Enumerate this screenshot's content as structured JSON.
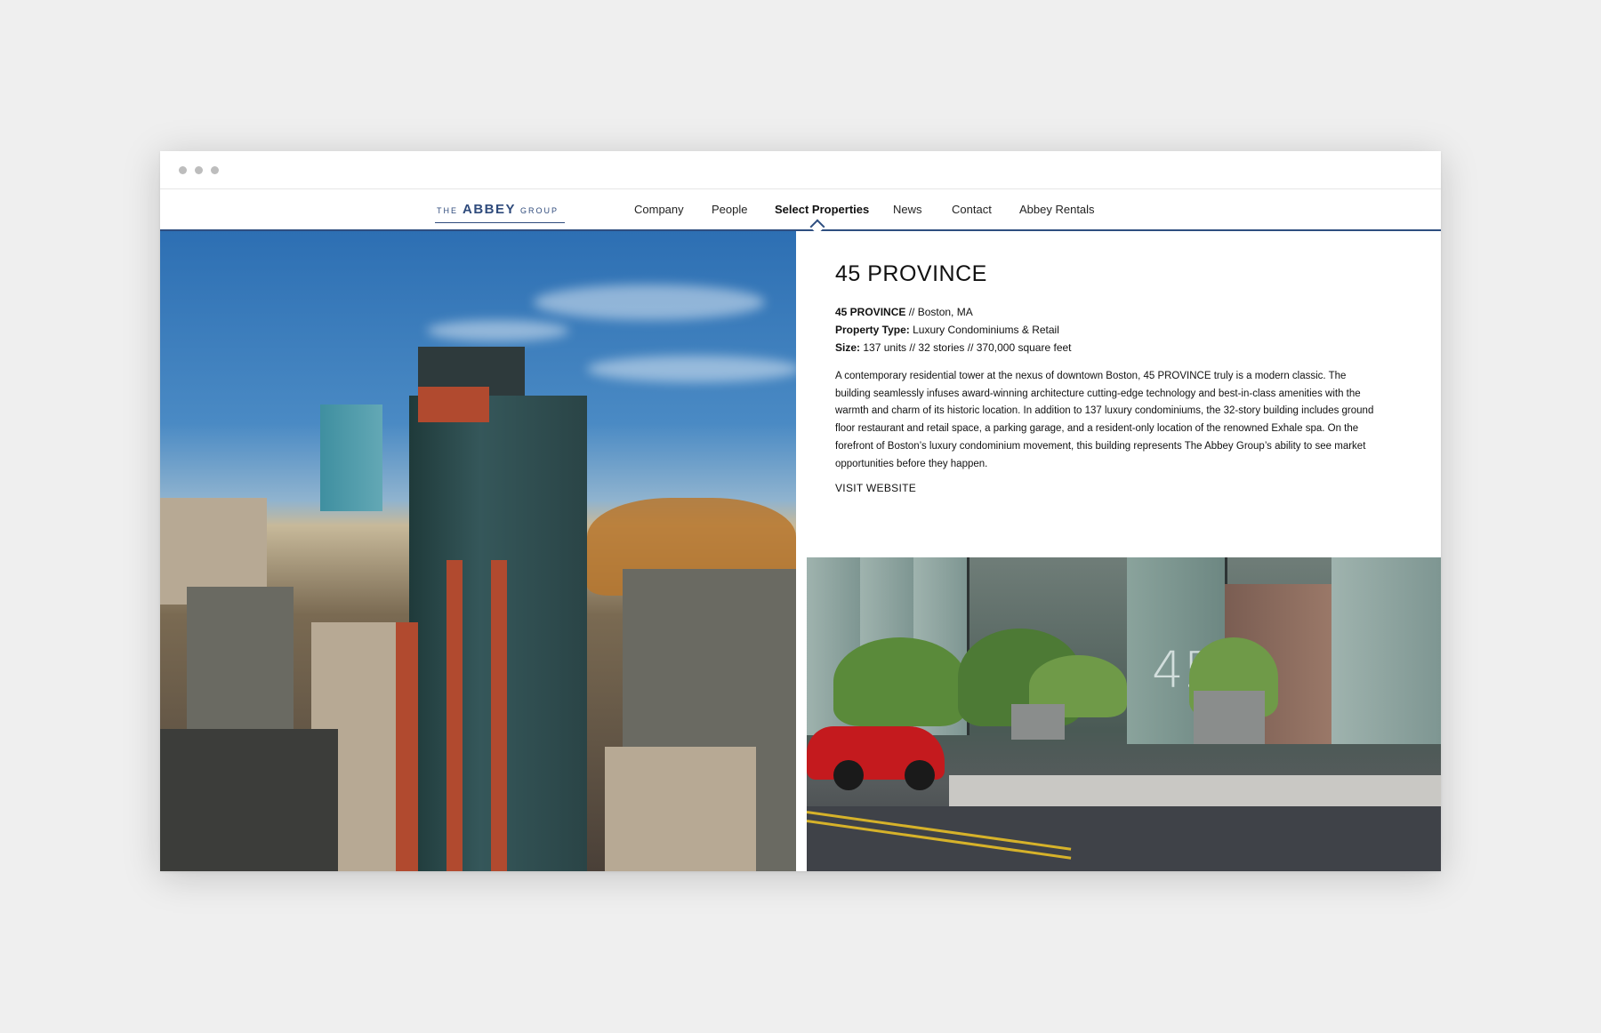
{
  "logo": {
    "prefix": "THE",
    "name": "ABBEY",
    "suffix": "GROUP"
  },
  "nav": {
    "items": [
      {
        "label": "Company",
        "active": false
      },
      {
        "label": "People",
        "active": false
      },
      {
        "label": "Select Properties",
        "active": true
      },
      {
        "label": "News",
        "active": false
      },
      {
        "label": "Contact",
        "active": false
      },
      {
        "label": "Abbey Rentals",
        "active": false
      }
    ]
  },
  "property": {
    "title": "45 PROVINCE",
    "name_label": "45 PROVINCE",
    "location": " // Boston, MA",
    "type_label": "Property Type:",
    "type_value": " Luxury Condominiums & Retail",
    "size_label": "Size:",
    "size_value": " 137 units // 32 stories // 370,000 square feet",
    "description": "A contemporary residential tower at the nexus of downtown Boston, 45 PROVINCE truly is a modern classic. The building seamlessly infuses award-winning architecture cutting-edge technology and best-in-class amenities with the warmth and charm of its historic location. In addition to 137 luxury condominiums, the 32-story building includes ground floor restaurant and retail space, a parking garage, and a resident-only location of the renowned Exhale spa. On the forefront of Boston’s luxury condominium movement, this building represents The Abbey Group’s ability to see market opportunities before they happen.",
    "visit_label": "VISIT WEBSITE"
  },
  "photos": {
    "entrance_sign": "45"
  },
  "colors": {
    "accent": "#2e4e80",
    "page_bg": "#efefef"
  }
}
